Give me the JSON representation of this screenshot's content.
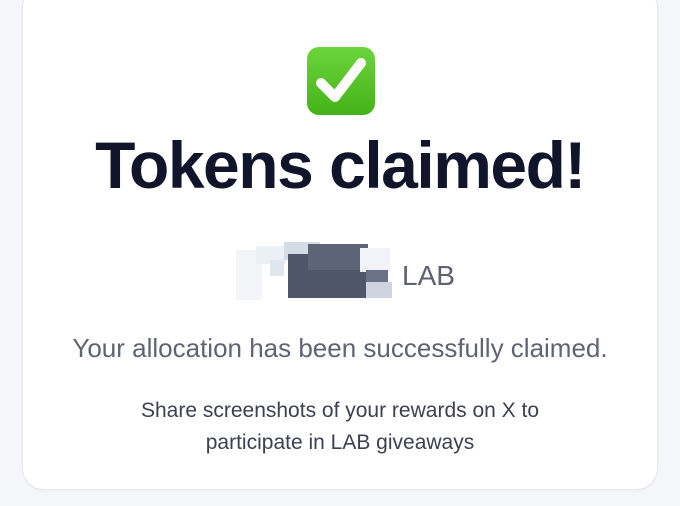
{
  "icons": {
    "status_icon": "check-mark-button-icon"
  },
  "colors": {
    "check_green": "#4cbb1f",
    "headline": "#10152b",
    "body_text": "#5f6472"
  },
  "claim": {
    "title": "Tokens claimed!",
    "amount_redacted": true,
    "token_symbol": "LAB",
    "status_message": "Your allocation has been successfully claimed.",
    "share_message": "Share screenshots of your rewards on X to participate in LAB giveaways"
  }
}
